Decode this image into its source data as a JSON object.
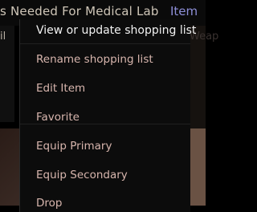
{
  "header": {
    "title": "s Needed For Medical Lab",
    "item_link": "Item"
  },
  "side": {
    "left_label": "il",
    "right_label": "Weap"
  },
  "menu": {
    "items": [
      "View or update shopping list",
      "Rename shopping list",
      "Edit Item",
      "Favorite",
      "Equip Primary",
      "Equip Secondary",
      "Drop"
    ]
  }
}
